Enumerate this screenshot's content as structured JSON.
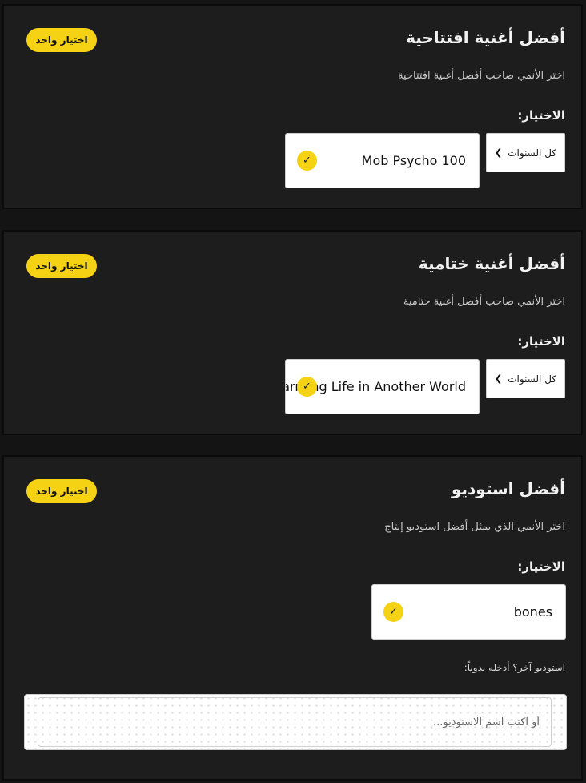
{
  "categories": [
    {
      "title": "أفضل أغنية افتتاحية",
      "badge": "اختيار واحد",
      "subtitle": "اختر الأنمي صاحب أفضل أغنية افتتاحية",
      "choice_label": "الاختيار:",
      "year_filter": "كل السنوات",
      "selection": "Mob Psycho 100"
    },
    {
      "title": "أفضل أغنية ختامية",
      "badge": "اختيار واحد",
      "subtitle": "اختر الأنمي صاحب أفضل أغنية ختامية",
      "choice_label": "الاختيار:",
      "year_filter": "كل السنوات",
      "selection": "Farming Life in Another World"
    },
    {
      "title": "أفضل استوديو",
      "badge": "اختيار واحد",
      "subtitle": "اختر الأنمي الذي يمثل أفضل استوديو إنتاج",
      "choice_label": "الاختيار:",
      "selection": "bones",
      "manual_label": "استوديو آخر؟ أدخله يدوياً:",
      "manual_placeholder": "أو اكتب اسم الاستوديو..."
    }
  ],
  "icons": {
    "check": "check-icon",
    "chevron": "chevron-down-icon"
  },
  "colors": {
    "background": "#141414",
    "card": "#1d1d1d",
    "accent": "#f5d214"
  }
}
